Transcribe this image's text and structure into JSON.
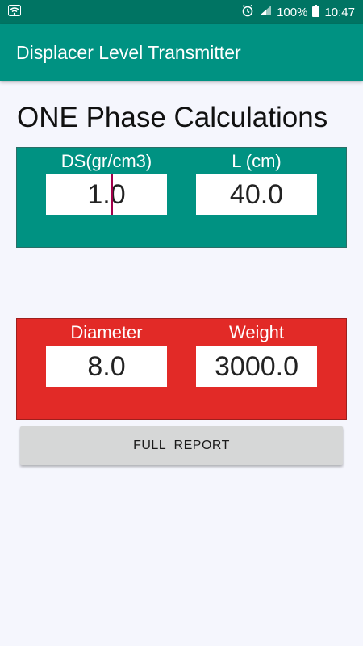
{
  "status_bar": {
    "battery_percent": "100%",
    "time": "10:47",
    "icons": [
      "wifi-icon",
      "alarm-icon",
      "signal-icon",
      "battery-icon"
    ]
  },
  "app_bar": {
    "title": "Displacer Level Transmitter"
  },
  "heading": "ONE Phase Calculations",
  "panel_one": {
    "color": "#009282",
    "ds_label": "DS(gr/cm3)",
    "ds_value": "1.0",
    "l_label": "L (cm)",
    "l_value": "40.0"
  },
  "panel_two": {
    "color": "#e22a27",
    "diameter_label": "Diameter",
    "diameter_value": "8.0",
    "weight_label": "Weight",
    "weight_value": "3000.0"
  },
  "report_button": {
    "label": "FULL  REPORT"
  }
}
